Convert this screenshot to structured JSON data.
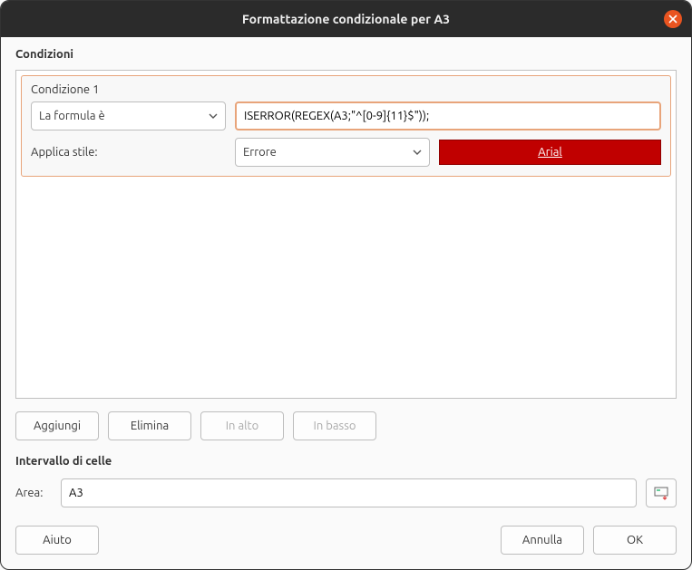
{
  "titlebar": {
    "title": "Formattazione condizionale per A3"
  },
  "conditions": {
    "heading": "Condizioni",
    "item": {
      "title": "Condizione 1",
      "type_label": "La formula è",
      "formula": "ISERROR(REGEX(A3;\"^[0-9]{11}$\"));",
      "apply_label": "Applica stile:",
      "style_label": "Errore",
      "preview_text": "Arial"
    },
    "buttons": {
      "add": "Aggiungi",
      "delete": "Elimina",
      "up": "In alto",
      "down": "In basso"
    }
  },
  "range": {
    "heading": "Intervallo di celle",
    "label": "Area:",
    "value": "A3"
  },
  "footer": {
    "help": "Aiuto",
    "cancel": "Annulla",
    "ok": "OK"
  }
}
